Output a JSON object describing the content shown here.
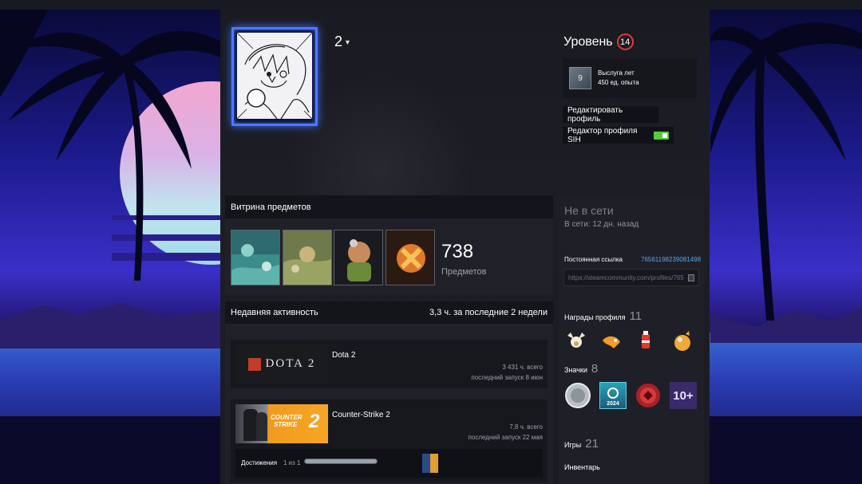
{
  "profile": {
    "username": "2",
    "level_label": "Уровень",
    "level": "14",
    "years": {
      "icon_value": "9",
      "title": "Выслуга лет",
      "xp": "450 ед. опыта"
    },
    "edit_button": "Редактировать профиль",
    "sih_button": "Редактор профиля SIH"
  },
  "showcase": {
    "title": "Витрина предметов",
    "count": "738",
    "count_label": "Предметов"
  },
  "activity": {
    "title": "Недавняя активность",
    "summary": "3,3 ч. за последние 2 недели",
    "games": [
      {
        "name": "Dota 2",
        "capsule_text": "DOTA 2",
        "hours": "3 431 ч. всего",
        "last_played": "последний запуск 8 июн"
      },
      {
        "name": "Counter-Strike 2",
        "capsule_text_1": "COUNTER",
        "capsule_text_2": "STRIKE",
        "capsule_text_3": "2",
        "hours": "7,8 ч. всего",
        "last_played": "последний запуск 22 мая",
        "achievements_label": "Достижения",
        "achievements_count": "1 из 1",
        "achievements_progress": 1.0
      }
    ]
  },
  "sidebar": {
    "status": "Не в сети",
    "last_online": "В сети: 12 дн. назад",
    "permalink_label": "Постоянная ссылка",
    "permalink_id": "76561198239081498",
    "permalink_url": "https://steamcommunity.com/profiles/765",
    "awards_label": "Награды профиля",
    "awards_count": "11",
    "badges_label": "Значки",
    "badges_count": "8",
    "badge_2024": "2024",
    "badge_10plus": "10+",
    "games_label": "Игры",
    "games_count": "21",
    "inventory_label": "Инвентарь"
  },
  "colors": {
    "accent_blue": "#57a7e8",
    "level_ring": "#e03a3a",
    "toggle_on": "#57cb3e",
    "avatar_frame": "#4a7bff"
  }
}
